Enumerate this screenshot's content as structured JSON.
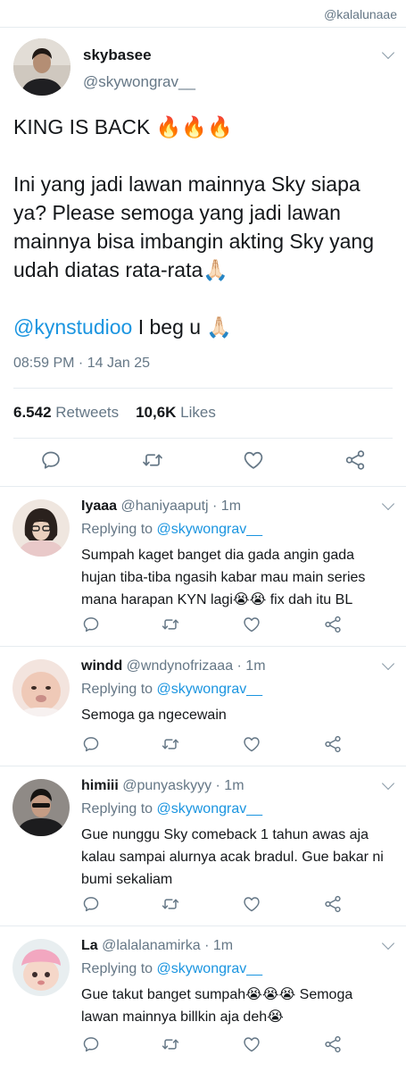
{
  "watermark": "@kalalunaae",
  "main_tweet": {
    "name": "skybasee",
    "handle": "@skywongrav__",
    "line1": "KING IS BACK 🔥🔥🔥",
    "line2": "Ini yang jadi lawan mainnya Sky siapa ya? Please semoga yang jadi lawan mainnya bisa imbangin akting Sky yang udah diatas rata-rata🙏🏻",
    "mention": "@kynstudioo",
    "line3": " I beg u 🙏🏻",
    "time": "08:59 PM · 14 Jan 25",
    "retweets_count": "6.542",
    "retweets_label": "Retweets",
    "likes_count": "10,6K",
    "likes_label": "Likes"
  },
  "replies": [
    {
      "name": "Iyaaa",
      "handle": "@haniyaaputj · 1m",
      "replying_prefix": "Replying to ",
      "replying_to": "@skywongrav__",
      "text": "Sumpah kaget banget dia gada angin gada hujan tiba-tiba ngasih kabar mau main series mana harapan KYN lagi😭😭 fix dah itu BL"
    },
    {
      "name": "windd",
      "handle": "@wndynofrizaaa · 1m",
      "replying_prefix": "Replying to ",
      "replying_to": "@skywongrav__",
      "text": "Semoga ga ngecewain"
    },
    {
      "name": "himiii",
      "handle": "@punyaskyyy · 1m",
      "replying_prefix": "Replying to ",
      "replying_to": "@skywongrav__",
      "text": "Gue nunggu Sky comeback 1 tahun awas aja kalau sampai alurnya acak bradul. Gue bakar ni bumi sekaliam"
    },
    {
      "name": "La",
      "handle": "@lalalanamirka · 1m",
      "replying_prefix": "Replying to ",
      "replying_to": "@skywongrav__",
      "text": "Gue takut banget sumpah😭😭😭 Semoga lawan mainnya billkin aja deh😭"
    }
  ],
  "icons": {
    "reply": "reply-icon",
    "retweet": "retweet-icon",
    "like": "heart-icon",
    "share": "share-icon",
    "more": "chevron-down-icon"
  },
  "colors": {
    "link": "#1b95e0",
    "secondary_text": "#657786",
    "icon": "#657786",
    "divider": "#e6ecf0"
  }
}
